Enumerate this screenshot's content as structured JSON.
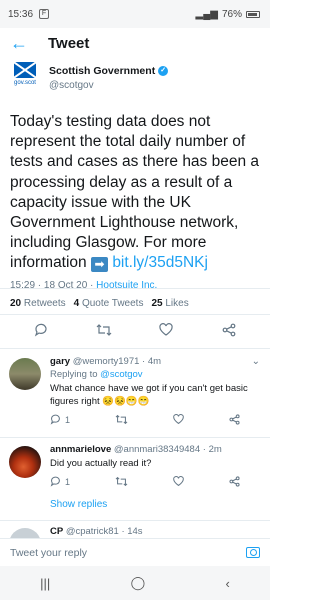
{
  "status_bar": {
    "time": "15:36",
    "battery": "76%"
  },
  "header": {
    "title": "Tweet"
  },
  "tweet": {
    "author_name": "Scottish Government",
    "handle": "@scotgov",
    "logo_text": "gov.scot",
    "text": "Today's testing data does not represent the total daily number of tests and cases as there has been a processing delay as a result of a capacity issue with the UK Government Lighthouse network, including Glasgow. For more information",
    "link": "bit.ly/35d5NKj",
    "time": "15:29 · 18 Oct 20 · ",
    "source": "Hootsuite Inc."
  },
  "stats": {
    "retweets_count": "20",
    "retweets_label": "Retweets",
    "quotes_count": "4",
    "quotes_label": "Quote Tweets",
    "likes_count": "25",
    "likes_label": "Likes"
  },
  "replies": [
    {
      "name": "gary",
      "handle": "@wemorty1971",
      "age": "· 4m",
      "replying_prefix": "Replying to ",
      "replying_to": "@scotgov",
      "text": "What chance have we got if you can't get basic figures right 😣😣😁😁",
      "reply_count": "1",
      "like_count": ""
    },
    {
      "name": "annmarielove",
      "handle": "@annmari38349484",
      "age": "· 2m",
      "text": "Did you actually read it?",
      "reply_count": "1",
      "show_replies": "Show replies"
    },
    {
      "name": "CP",
      "handle": "@cpatrick81",
      "age": "· 14s"
    }
  ],
  "compose": {
    "placeholder": "Tweet your reply"
  },
  "colors": {
    "accent": "#1da1f2",
    "text": "#14171a",
    "muted": "#657786"
  }
}
